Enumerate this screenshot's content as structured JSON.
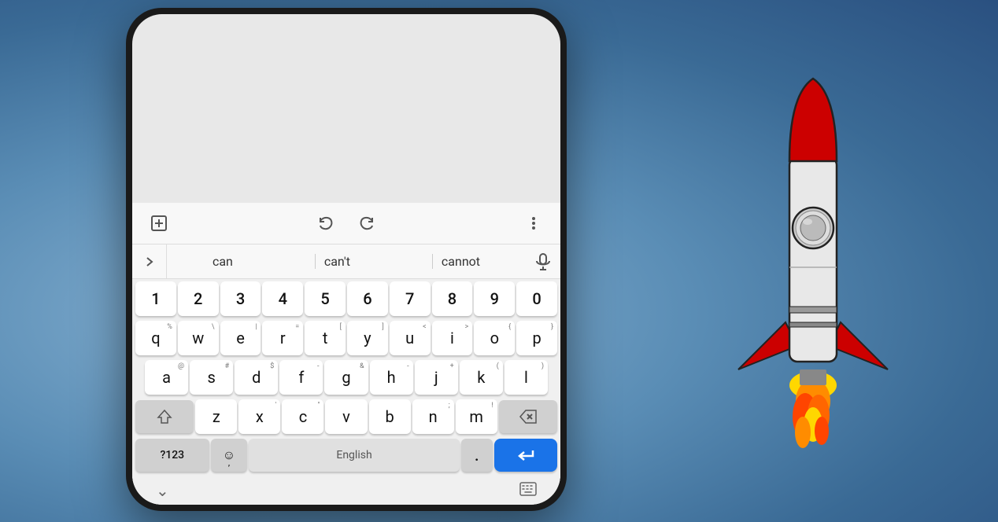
{
  "background": {
    "color_start": "#8ab4d4",
    "color_end": "#2a5080"
  },
  "toolbar": {
    "add_icon": "➕",
    "undo_icon": "↩",
    "redo_icon": "↪",
    "more_icon": "⋮"
  },
  "suggestions": {
    "arrow_icon": "›",
    "words": [
      "can",
      "can't",
      "cannot"
    ],
    "mic_icon": "🎤"
  },
  "number_row": [
    "1",
    "2",
    "3",
    "4",
    "5",
    "6",
    "7",
    "8",
    "9",
    "0"
  ],
  "qwerty_row": [
    {
      "letter": "q",
      "super": "%"
    },
    {
      "letter": "w",
      "super": "\\"
    },
    {
      "letter": "e",
      "super": "|"
    },
    {
      "letter": "r",
      "super": "="
    },
    {
      "letter": "t",
      "super": "["
    },
    {
      "letter": "y",
      "super": "]"
    },
    {
      "letter": "u",
      "super": "<"
    },
    {
      "letter": "i",
      "super": ">"
    },
    {
      "letter": "o",
      "super": "{"
    },
    {
      "letter": "p",
      "super": "}"
    }
  ],
  "asdf_row": [
    {
      "letter": "a",
      "super": "@"
    },
    {
      "letter": "s",
      "super": "#"
    },
    {
      "letter": "d",
      "super": "$"
    },
    {
      "letter": "f",
      "super": "-"
    },
    {
      "letter": "g",
      "super": "&"
    },
    {
      "letter": "h",
      "super": "-"
    },
    {
      "letter": "j",
      "super": "+"
    },
    {
      "letter": "k",
      "super": "("
    },
    {
      "letter": "l",
      "super": ")"
    }
  ],
  "zxcv_row": [
    {
      "letter": "z",
      "super": ""
    },
    {
      "letter": "x",
      "super": "'"
    },
    {
      "letter": "c",
      "super": "\""
    },
    {
      "letter": "v",
      "super": ""
    },
    {
      "letter": "b",
      "super": ""
    },
    {
      "letter": "n",
      "super": ";"
    },
    {
      "letter": "m",
      "super": "!"
    }
  ],
  "bottom_row": {
    "special": "?123",
    "emoji": "☺",
    "comma": ",",
    "space_label": "English",
    "period": ".",
    "enter_icon": "↵"
  },
  "bottom_nav": {
    "down_icon": "⌄",
    "keyboard_icon": "⌨"
  }
}
